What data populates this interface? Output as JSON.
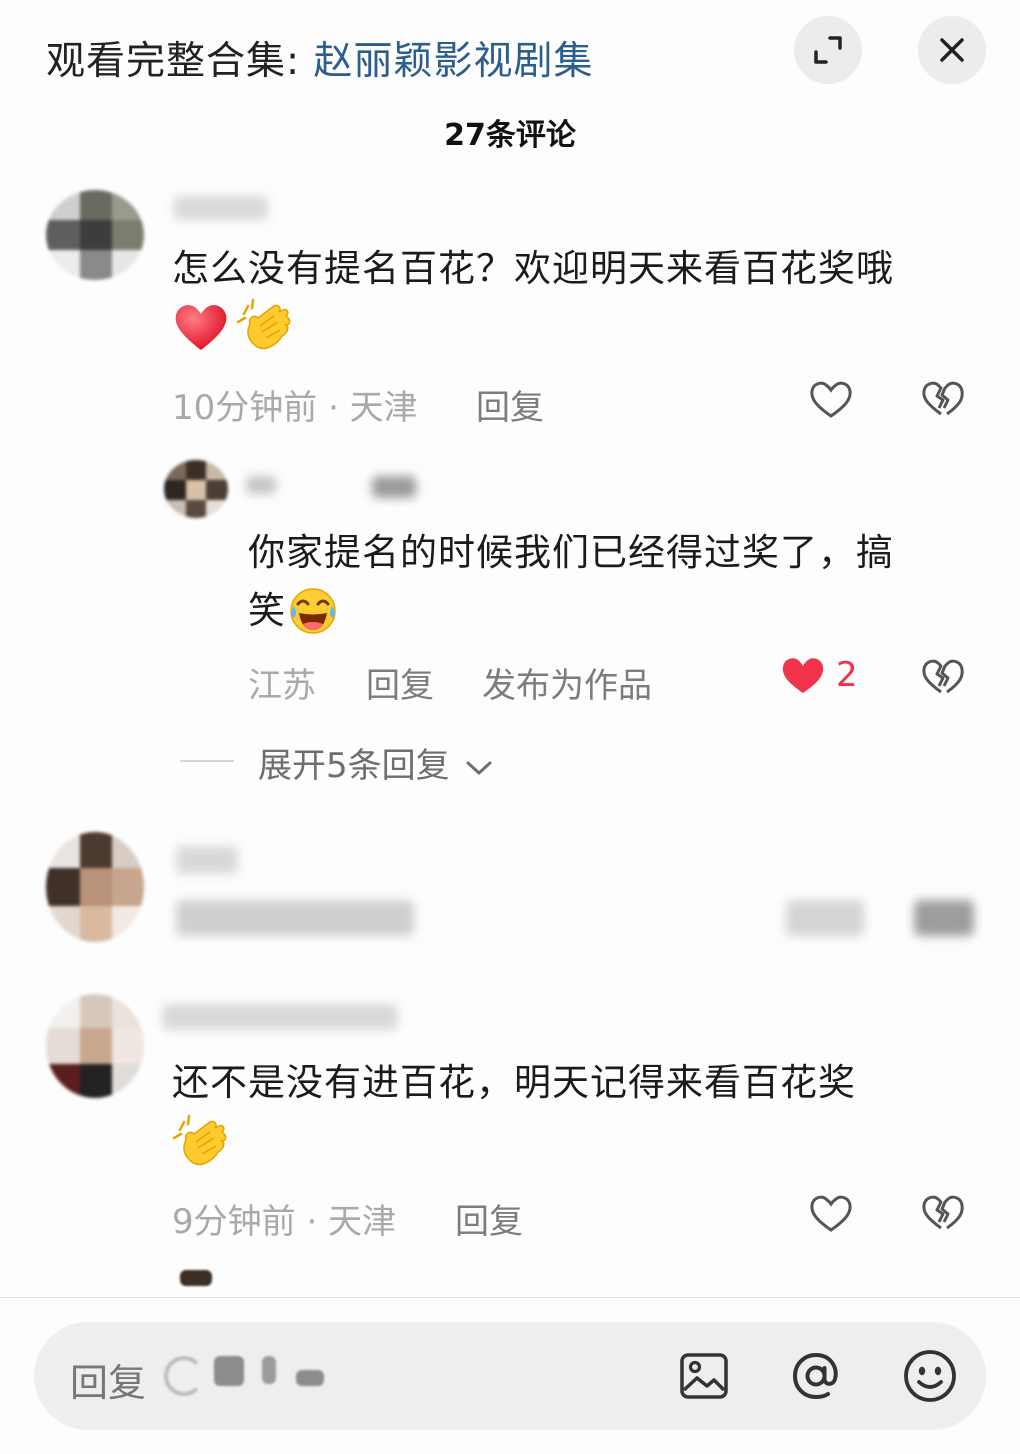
{
  "header": {
    "title_prefix": "观看完整合集: ",
    "title_link": "赵丽颖影视剧集",
    "expand_icon": "expand-icon",
    "close_icon": "close-icon"
  },
  "comment_count": "27条评论",
  "comments": [
    {
      "text_line1": "怎么没有提名百花？欢迎明天来看百花奖哦",
      "emoji": [
        "red-heart-emoji",
        "clapping-hands-emoji"
      ],
      "time_location": "10分钟前 · 天津",
      "reply_label": "回复",
      "reply": {
        "text_line1": "你家提名的时候我们已经得过奖了，搞",
        "text_line2": "笑",
        "emoji": [
          "tears-of-joy-emoji"
        ],
        "location": "江苏",
        "reply_label": "回复",
        "publish_label": "发布为作品",
        "like_count": "2"
      },
      "expand_label": "展开5条回复"
    },
    {
      "text_line1": "还不是没有进百花，明天记得来看百花奖",
      "emoji": [
        "clapping-hands-emoji"
      ],
      "time_location": "9分钟前 · 天津",
      "reply_label": "回复"
    }
  ],
  "input": {
    "placeholder": "回复",
    "icons": [
      "image-icon",
      "at-icon",
      "emoji-icon"
    ]
  },
  "colors": {
    "accent_link": "#2c5d8f",
    "liked_heart": "#f0334a",
    "meta_gray": "#a9a9a9"
  }
}
